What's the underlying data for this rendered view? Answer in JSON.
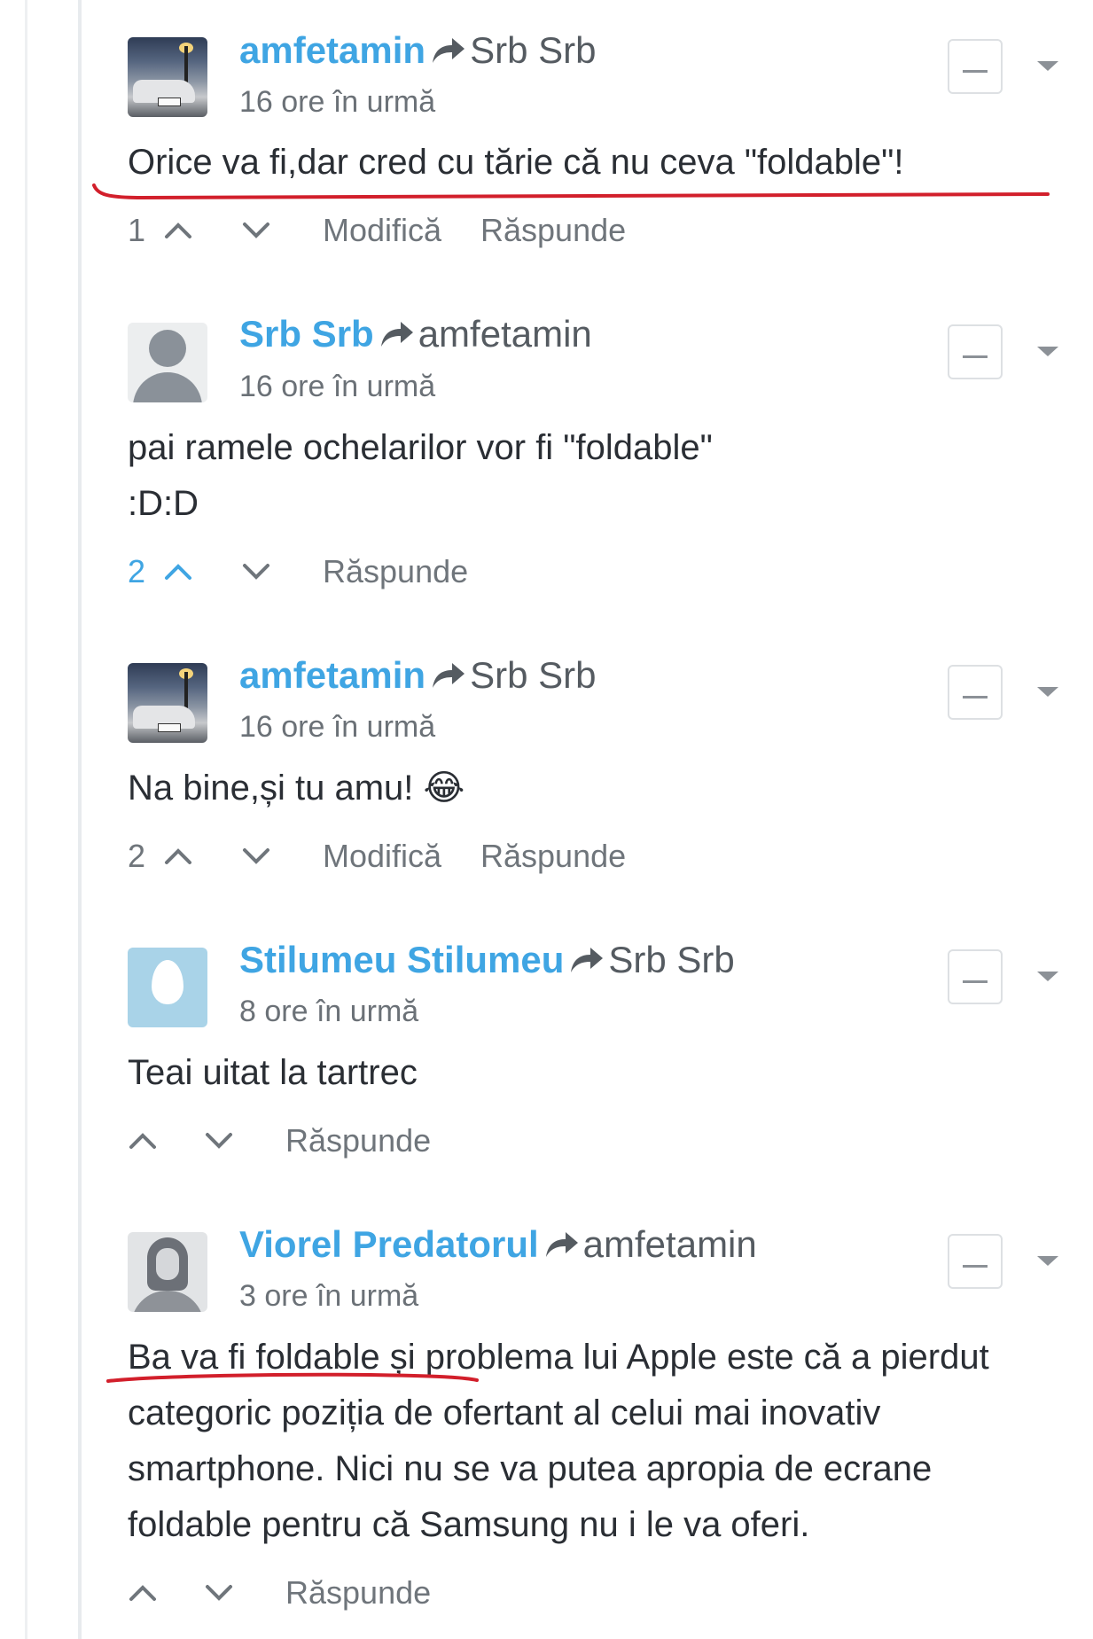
{
  "comments": [
    {
      "author": "amfetamin",
      "recipient": "Srb Srb",
      "time": "16 ore în urmă",
      "text": "Orice va fi,dar cred cu tărie că nu ceva \"foldable\"!",
      "votes": "1",
      "votes_active": false,
      "actions": [
        "Modifică",
        "Răspunde"
      ],
      "avatar_icon": "car-photo-avatar"
    },
    {
      "author": "Srb Srb",
      "recipient": "amfetamin",
      "time": "16 ore în urmă",
      "text": "pai ramele ochelarilor vor fi \"foldable\"\n:D:D",
      "votes": "2",
      "votes_active": true,
      "actions": [
        "Răspunde"
      ],
      "avatar_icon": "default-user-avatar"
    },
    {
      "author": "amfetamin",
      "recipient": "Srb Srb",
      "time": "16 ore în urmă",
      "text": "Na bine,și tu amu! 😂",
      "votes": "2",
      "votes_active": false,
      "actions": [
        "Modifică",
        "Răspunde"
      ],
      "avatar_icon": "car-photo-avatar"
    },
    {
      "author": "Stilumeu Stilumeu",
      "recipient": "Srb Srb",
      "time": "8 ore în urmă",
      "text": "Teai uitat la tartrec",
      "votes": "",
      "votes_active": false,
      "actions": [
        "Răspunde"
      ],
      "avatar_icon": "egg-avatar"
    },
    {
      "author": "Viorel Predatorul",
      "recipient": "amfetamin",
      "time": "3 ore în urmă",
      "text": "Ba va fi foldable și problema lui Apple este că a pierdut categoric poziția de ofertant al celui mai inovativ smartphone. Nici nu se va putea apropia de ecrane foldable pentru că Samsung nu i le va oferi.",
      "votes": "",
      "votes_active": false,
      "actions": [
        "Răspunde"
      ],
      "avatar_icon": "sketch-portrait-avatar"
    }
  ],
  "colors": {
    "author": "#3fa5e3",
    "recipient": "#555b61",
    "text": "#2a2e34",
    "meta": "#6b7177",
    "annotation": "#d21f2b"
  },
  "icons": {
    "reply_to": "reply-arrow-icon",
    "upvote": "chevron-up-icon",
    "downvote": "chevron-down-icon",
    "collapse": "minus-icon",
    "menu": "caret-down-icon"
  }
}
